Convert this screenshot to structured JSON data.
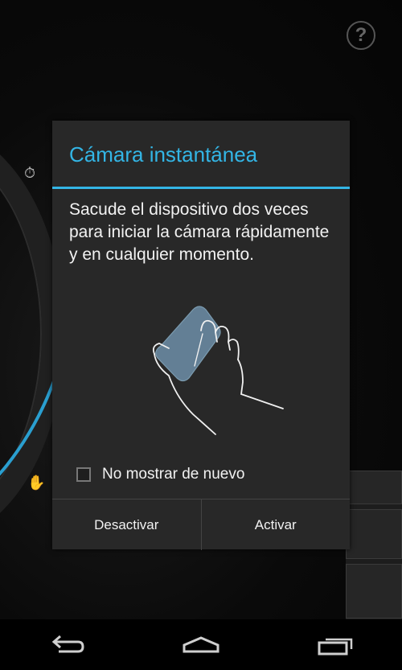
{
  "dialog": {
    "title": "Cámara instantánea",
    "message": "Sacude el dispositivo dos veces para iniciar la cámara rápidamente y en cualquier momento.",
    "checkbox_label": "No mostrar de nuevo",
    "checkbox_checked": false,
    "negative_button": "Desactivar",
    "positive_button": "Activar",
    "illustration": "hand-shaking-phone-illustration"
  },
  "camera": {
    "help_label": "?"
  },
  "nav": {
    "back": "back-icon",
    "home": "home-icon",
    "recents": "recent-apps-icon"
  },
  "colors": {
    "accent": "#33b5e5",
    "dialog_bg": "#282828",
    "text": "#f2f2f2"
  }
}
